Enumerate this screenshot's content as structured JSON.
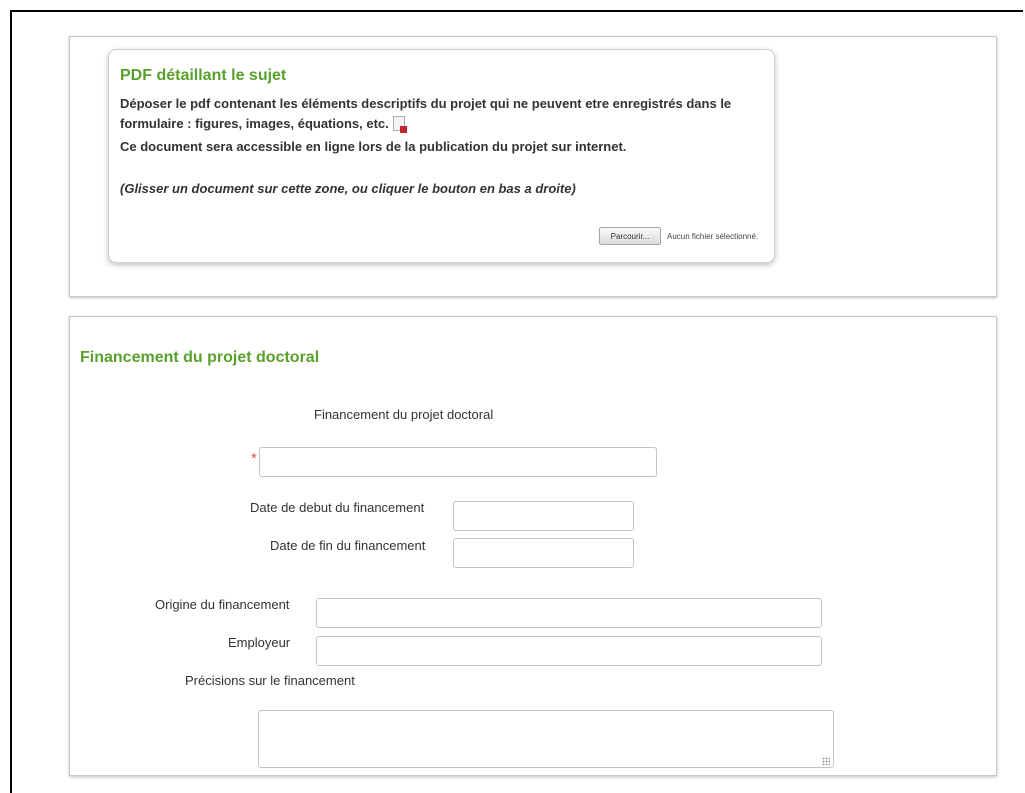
{
  "upload": {
    "title": "PDF détaillant le sujet",
    "line1": "Déposer le pdf contenant les éléments descriptifs du projet qui ne peuvent etre enregistrés dans le",
    "line2": "formulaire : figures, images, équations, etc.",
    "line3": "Ce document sera accessible en ligne lors de la publication du projet sur internet.",
    "hint": "(Glisser un document sur cette zone, ou cliquer le bouton en bas a droite)",
    "browse_label": "Parcourir...",
    "no_file_label": "Aucun fichier sélectionné.",
    "icon": "pdf-file-icon"
  },
  "funding": {
    "section_title": "Financement du projet doctoral",
    "fields": {
      "project_funding": {
        "label": "Financement du projet doctoral",
        "value": "",
        "required": true,
        "required_mark": "*"
      },
      "start_date": {
        "label": "Date de debut du financement",
        "value": ""
      },
      "end_date": {
        "label": "Date de fin du financement",
        "value": ""
      },
      "origin": {
        "label": "Origine du financement",
        "value": ""
      },
      "employer": {
        "label": "Employeur",
        "value": ""
      },
      "details": {
        "label": "Précisions sur le financement",
        "value": ""
      }
    }
  },
  "colors": {
    "heading_green": "#5aa02c",
    "required_red": "#d9534f",
    "border_gray": "#c4c4c4"
  }
}
